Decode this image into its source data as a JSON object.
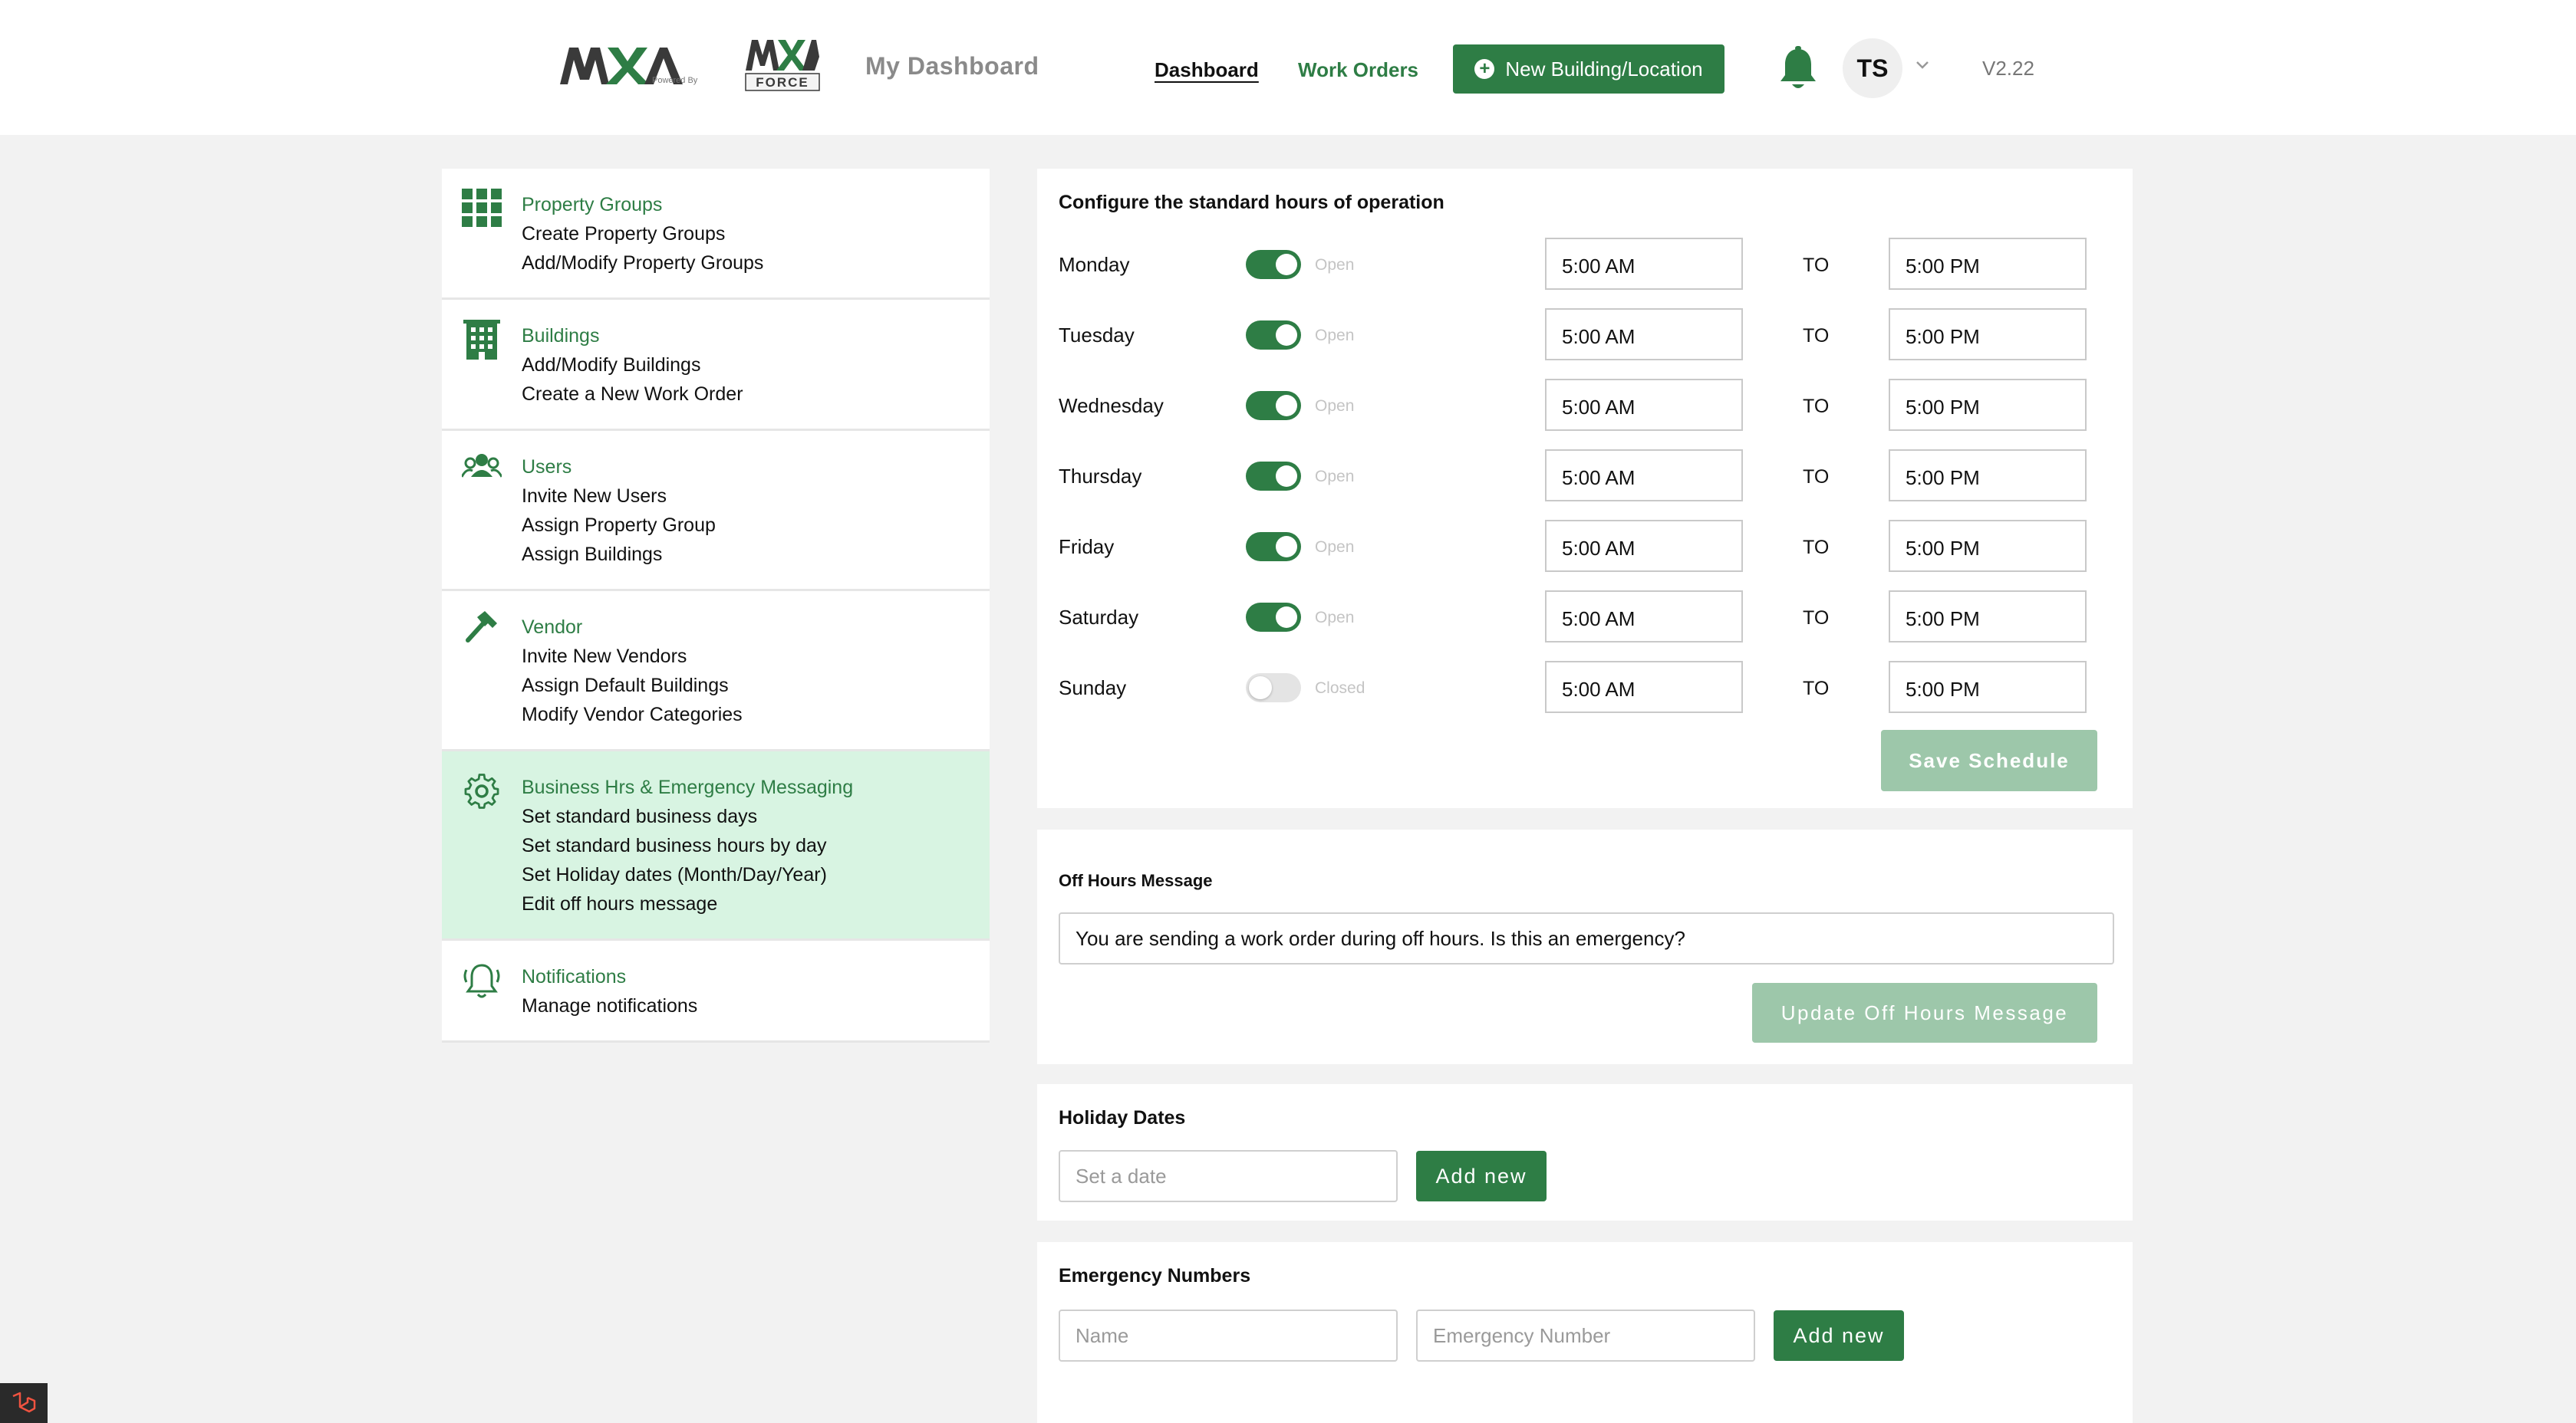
{
  "header": {
    "logo_brand": "MXA",
    "logo_powered_by": "Powered By",
    "logo_force": "FORCE",
    "page_title": "My Dashboard",
    "nav": {
      "dashboard": "Dashboard",
      "work_orders": "Work Orders"
    },
    "new_building_label": "New Building/Location",
    "avatar_initials": "TS",
    "version": "V2.22"
  },
  "sidebar": {
    "items": [
      {
        "title": "Property Groups",
        "icon": "grid-icon",
        "links": [
          "Create Property Groups",
          "Add/Modify Property Groups"
        ]
      },
      {
        "title": "Buildings",
        "icon": "building-icon",
        "links": [
          "Add/Modify Buildings",
          "Create a New Work Order"
        ]
      },
      {
        "title": "Users",
        "icon": "users-icon",
        "links": [
          "Invite New Users",
          "Assign Property Group",
          "Assign Buildings"
        ]
      },
      {
        "title": "Vendor",
        "icon": "hammer-icon",
        "links": [
          "Invite New Vendors",
          "Assign Default Buildings",
          "Modify Vendor Categories"
        ]
      },
      {
        "title": "Business Hrs & Emergency Messaging",
        "icon": "gear-icon",
        "links": [
          "Set standard business days",
          "Set standard business hours by day",
          "Set Holiday dates (Month/Day/Year)",
          "Edit off hours message"
        ]
      },
      {
        "title": "Notifications",
        "icon": "bell-ring-icon",
        "links": [
          "Manage notifications"
        ]
      }
    ]
  },
  "hours": {
    "heading": "Configure the standard hours of operation",
    "to_label": "TO",
    "days": [
      {
        "name": "Monday",
        "open": true,
        "status": "Open",
        "from": "5:00 AM",
        "to": "5:00 PM"
      },
      {
        "name": "Tuesday",
        "open": true,
        "status": "Open",
        "from": "5:00 AM",
        "to": "5:00 PM"
      },
      {
        "name": "Wednesday",
        "open": true,
        "status": "Open",
        "from": "5:00 AM",
        "to": "5:00 PM"
      },
      {
        "name": "Thursday",
        "open": true,
        "status": "Open",
        "from": "5:00 AM",
        "to": "5:00 PM"
      },
      {
        "name": "Friday",
        "open": true,
        "status": "Open",
        "from": "5:00 AM",
        "to": "5:00 PM"
      },
      {
        "name": "Saturday",
        "open": true,
        "status": "Open",
        "from": "5:00 AM",
        "to": "5:00 PM"
      },
      {
        "name": "Sunday",
        "open": false,
        "status": "Closed",
        "from": "5:00 AM",
        "to": "5:00 PM"
      }
    ],
    "save_label": "Save Schedule"
  },
  "off_hours": {
    "heading": "Off Hours Message",
    "message": "You are sending a work order during off hours. Is this an emergency?",
    "update_label": "Update Off Hours Message"
  },
  "holidays": {
    "heading": "Holiday Dates",
    "date_placeholder": "Set a date",
    "add_label": "Add new"
  },
  "emergency": {
    "heading": "Emergency Numbers",
    "name_placeholder": "Name",
    "number_placeholder": "Emergency Number",
    "add_label": "Add new"
  },
  "colors": {
    "brand_green": "#2e7d45",
    "muted_green": "#9dc7aa",
    "active_bg": "#d8f4e2",
    "page_bg": "#f2f2f2"
  }
}
